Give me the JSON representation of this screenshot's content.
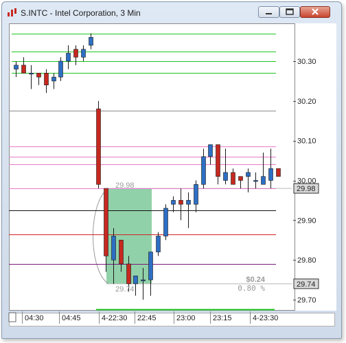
{
  "window": {
    "title": "S.INTC - Intel Corporation, 3 Min"
  },
  "colors": {
    "up": "#2d6fc4",
    "down": "#c62820",
    "green": "#1fc41f",
    "gray": "#8a8a8a",
    "pink": "#e77bc9",
    "box": "#7ec99a"
  },
  "chart_data": {
    "type": "candlestick",
    "y_range": [
      29.67,
      30.38
    ],
    "y_ticks": [
      "30.30",
      "30.20",
      "30.10",
      "30.00",
      "29.90",
      "29.80",
      "29.70"
    ],
    "y_tick_values": [
      30.3,
      30.2,
      30.1,
      30.0,
      29.9,
      29.8,
      29.7
    ],
    "x_ticks": [
      "04:30",
      "04:45",
      "4-22:30",
      "22:45",
      "23:00",
      "23:15",
      "4-23:30"
    ],
    "price_tags": [
      {
        "label": "29.98",
        "value": 29.98
      },
      {
        "label": "29.74",
        "value": 29.74
      }
    ],
    "candles": [
      {
        "o": 30.28,
        "h": 30.3,
        "l": 30.26,
        "c": 30.29
      },
      {
        "o": 30.29,
        "h": 30.31,
        "l": 30.27,
        "c": 30.27
      },
      {
        "o": 30.27,
        "h": 30.29,
        "l": 30.23,
        "c": 30.27
      },
      {
        "o": 30.27,
        "h": 30.27,
        "l": 30.24,
        "c": 30.26
      },
      {
        "o": 30.27,
        "h": 30.28,
        "l": 30.22,
        "c": 30.24
      },
      {
        "o": 30.25,
        "h": 30.27,
        "l": 30.23,
        "c": 30.26
      },
      {
        "o": 30.26,
        "h": 30.31,
        "l": 30.25,
        "c": 30.3
      },
      {
        "o": 30.3,
        "h": 30.34,
        "l": 30.28,
        "c": 30.32
      },
      {
        "o": 30.33,
        "h": 30.34,
        "l": 30.29,
        "c": 30.31
      },
      {
        "o": 30.31,
        "h": 30.34,
        "l": 30.3,
        "c": 30.33
      },
      {
        "o": 30.34,
        "h": 30.37,
        "l": 30.33,
        "c": 30.36
      },
      {
        "o": 30.18,
        "h": 30.2,
        "l": 29.98,
        "c": 29.99
      },
      {
        "o": 29.98,
        "h": 29.98,
        "l": 29.77,
        "c": 29.81
      },
      {
        "o": 29.8,
        "h": 29.88,
        "l": 29.74,
        "c": 29.86
      },
      {
        "o": 29.85,
        "h": 29.85,
        "l": 29.77,
        "c": 29.79
      },
      {
        "o": 29.79,
        "h": 29.81,
        "l": 29.72,
        "c": 29.74
      },
      {
        "o": 29.74,
        "h": 29.76,
        "l": 29.71,
        "c": 29.76
      },
      {
        "o": 29.75,
        "h": 29.78,
        "l": 29.7,
        "c": 29.75
      },
      {
        "o": 29.75,
        "h": 29.82,
        "l": 29.71,
        "c": 29.82
      },
      {
        "o": 29.82,
        "h": 29.87,
        "l": 29.81,
        "c": 29.86
      },
      {
        "o": 29.86,
        "h": 29.94,
        "l": 29.85,
        "c": 29.93
      },
      {
        "o": 29.94,
        "h": 29.96,
        "l": 29.92,
        "c": 29.95
      },
      {
        "o": 29.95,
        "h": 29.98,
        "l": 29.9,
        "c": 29.94
      },
      {
        "o": 29.94,
        "h": 29.97,
        "l": 29.88,
        "c": 29.95
      },
      {
        "o": 29.94,
        "h": 30.0,
        "l": 29.92,
        "c": 29.99
      },
      {
        "o": 29.99,
        "h": 30.08,
        "l": 29.98,
        "c": 30.06
      },
      {
        "o": 30.06,
        "h": 30.09,
        "l": 30.04,
        "c": 30.09
      },
      {
        "o": 30.09,
        "h": 30.09,
        "l": 29.99,
        "c": 30.01
      },
      {
        "o": 30.0,
        "h": 30.08,
        "l": 29.99,
        "c": 30.02
      },
      {
        "o": 30.02,
        "h": 30.03,
        "l": 29.99,
        "c": 29.99
      },
      {
        "o": 30.01,
        "h": 30.01,
        "l": 29.98,
        "c": 30.0
      },
      {
        "o": 30.01,
        "h": 30.03,
        "l": 29.97,
        "c": 30.02
      },
      {
        "o": 30.0,
        "h": 30.02,
        "l": 29.98,
        "c": 30.0
      },
      {
        "o": 29.99,
        "h": 30.07,
        "l": 29.99,
        "c": 30.01
      },
      {
        "o": 30.0,
        "h": 30.08,
        "l": 29.98,
        "c": 30.03
      },
      {
        "o": 30.03,
        "h": 30.03,
        "l": 30.01,
        "c": 30.01
      }
    ],
    "levels": [
      {
        "value": 30.37,
        "color": "green",
        "style": "solid"
      },
      {
        "value": 30.325,
        "color": "green",
        "style": "solid"
      },
      {
        "value": 30.3,
        "color": "green",
        "style": "solid"
      },
      {
        "value": 30.27,
        "color": "green",
        "style": "solid"
      },
      {
        "value": 30.175,
        "color": "gray",
        "style": "solid"
      },
      {
        "value": 30.085,
        "color": "pink",
        "style": "solid"
      },
      {
        "value": 30.06,
        "color": "pink",
        "style": "solid"
      },
      {
        "value": 30.04,
        "color": "pink",
        "style": "solid"
      },
      {
        "value": 29.98,
        "color": "pink",
        "style": "solid"
      },
      {
        "value": 29.925,
        "color": "black",
        "style": "solid"
      },
      {
        "value": 29.865,
        "color": "red",
        "style": "solid"
      },
      {
        "value": 29.79,
        "color": "purple",
        "style": "solid"
      }
    ],
    "measure_box": {
      "high": 29.98,
      "low": 29.74,
      "high_label": "29.98",
      "low_label": "29.74",
      "change_label": "$0.24",
      "percent_label": "0.80 %"
    }
  }
}
